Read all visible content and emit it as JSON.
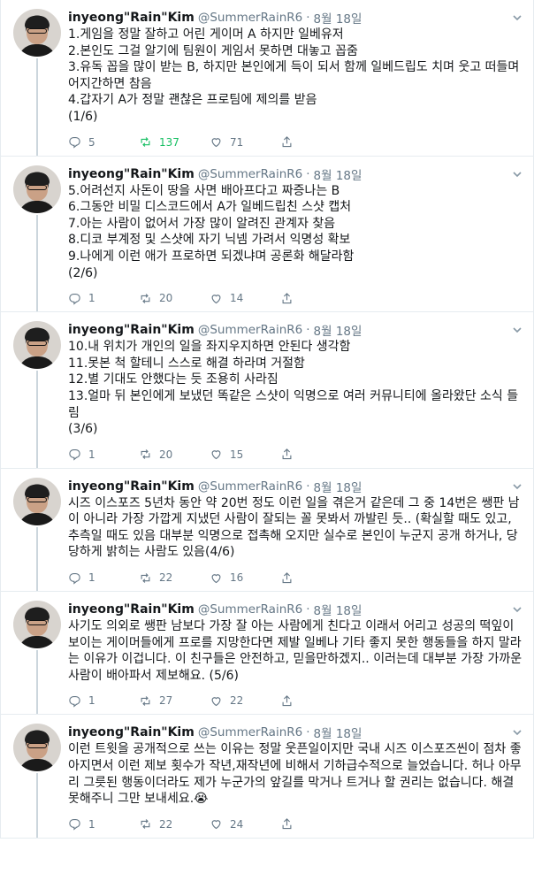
{
  "tweets": [
    {
      "name": "inyeong\"Rain\"Kim",
      "handle": "@SummerRainR6",
      "dot": "·",
      "date": "8월 18일",
      "text": "1.게임을 정말 잘하고 어린 게이머 A 하지만 일베유저\n2.본인도 그걸 알기에 팀원이 게임서 못하면 대놓고 꼽줌\n3.유독 꼽을 많이 받는 B, 하지만 본인에게 득이 되서 함께 일베드립도 치며 웃고 떠들며 어지간하면 참음\n4.갑자기 A가 정말 괜찮은 프로팀에 제의를 받음\n(1/6)",
      "replies": "5",
      "retweets": "137",
      "likes": "71",
      "retweeted": true
    },
    {
      "name": "inyeong\"Rain\"Kim",
      "handle": "@SummerRainR6",
      "dot": "·",
      "date": "8월 18일",
      "text": "5.어려선지 사돈이 땅을 사면 배아프다고 짜증나는 B\n6.그동안 비밀 디스코드에서 A가 일베드립친 스샷 캡처\n7.아는 사람이 없어서 가장 많이 알려진 관계자 찾음\n8.디코 부계정 및 스샷에 자기 닉넴 가려서 익명성 확보\n9.나에게 이런 애가 프로하면 되겠냐며 공론화 해달라함\n(2/6)",
      "replies": "1",
      "retweets": "20",
      "likes": "14",
      "retweeted": false
    },
    {
      "name": "inyeong\"Rain\"Kim",
      "handle": "@SummerRainR6",
      "dot": "·",
      "date": "8월 18일",
      "text": "10.내 위치가 개인의 일을 좌지우지하면 안된다 생각함\n11.못본 척 할테니 스스로 해결 하라며 거절함\n12.별 기대도 안했다는 듯 조용히 사라짐\n13.얼마 뒤 본인에게 보냈던 똑같은 스샷이 익명으로 여러 커뮤니티에 올라왔단 소식 들림\n(3/6)",
      "replies": "1",
      "retweets": "20",
      "likes": "15",
      "retweeted": false
    },
    {
      "name": "inyeong\"Rain\"Kim",
      "handle": "@SummerRainR6",
      "dot": "·",
      "date": "8월 18일",
      "text": "시즈 이스포즈 5년차 동안 약 20번 정도 이런 일을 겪은거 같은데 그 중 14번은 쌩판 남이 아니라 가장 가깝게 지냈던 사람이 잘되는 꼴 못봐서 까발린 듯.. (확실할 때도 있고, 추측일 때도 있음 대부분 익명으로 접촉해 오지만 실수로 본인이 누군지 공개 하거나, 당당하게 밝히는 사람도 있음(4/6)",
      "replies": "1",
      "retweets": "22",
      "likes": "16",
      "retweeted": false
    },
    {
      "name": "inyeong\"Rain\"Kim",
      "handle": "@SummerRainR6",
      "dot": "·",
      "date": "8월 18일",
      "text": "사기도 의외로 쌩판 남보다 가장 잘 아는 사람에게 친다고 이래서 어리고 성공의 떡잎이 보이는 게이머들에게 프로를 지망한다면 제발 일베나 기타 좋지 못한 행동들을 하지 말라는 이유가 이겁니다. 이 친구들은 안전하고, 믿을만하겠지.. 이러는데 대부분 가장 가까운 사람이 배아파서 제보해요. (5/6)",
      "replies": "1",
      "retweets": "27",
      "likes": "22",
      "retweeted": false
    },
    {
      "name": "inyeong\"Rain\"Kim",
      "handle": "@SummerRainR6",
      "dot": "·",
      "date": "8월 18일",
      "text": "이런 트윗을 공개적으로 쓰는 이유는 정말 웃픈일이지만 국내 시즈 이스포즈씬이 점차 좋아지면서 이런 제보 횟수가 작년,재작년에 비해서 기하급수적으로 늘었습니다. 허나 아무리 그릇된 행동이더라도 제가 누군가의 앞길를 막거나 트거나 할 권리는 없습니다. 해결 못해주니 그만 보내세요.😭",
      "replies": "1",
      "retweets": "22",
      "likes": "24",
      "retweeted": false
    }
  ],
  "colors": {
    "muted": "#657786",
    "retweet_green": "#17bf63",
    "thread_line": "#ccd6dd"
  },
  "icons": [
    "reply-icon",
    "retweet-icon",
    "like-icon",
    "share-icon",
    "chevron-down-icon"
  ]
}
